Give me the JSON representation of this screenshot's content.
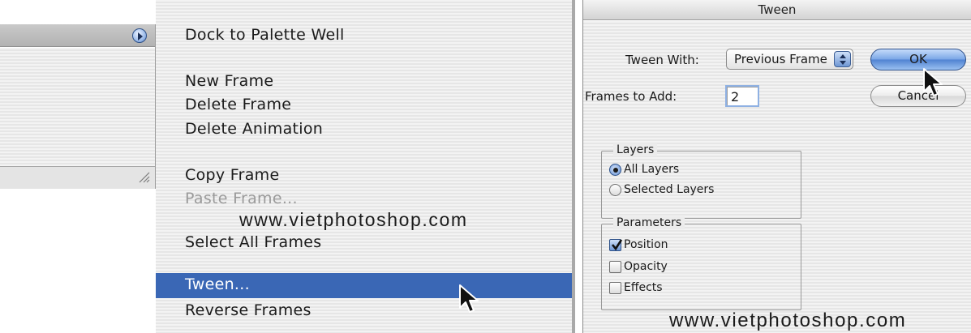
{
  "palette": {
    "menu_button_icon": "palette-menu-icon",
    "resize_icon": "resize-grip-icon"
  },
  "menu": {
    "items": [
      {
        "label": "Dock to Palette Well",
        "state": "normal"
      },
      {
        "label": "New Frame",
        "state": "normal"
      },
      {
        "label": "Delete Frame",
        "state": "normal"
      },
      {
        "label": "Delete Animation",
        "state": "normal"
      },
      {
        "label": "Copy Frame",
        "state": "normal"
      },
      {
        "label": "Paste Frame...",
        "state": "disabled"
      },
      {
        "label": "Select All Frames",
        "state": "normal"
      },
      {
        "label": "Tween...",
        "state": "selected"
      },
      {
        "label": "Reverse Frames",
        "state": "normal"
      }
    ],
    "highlight_color": "#3a67b5"
  },
  "watermark_text": "www.vietphotoshop.com",
  "dialog": {
    "title": "Tween",
    "tween_with_label": "Tween With:",
    "tween_with_value": "Previous Frame",
    "frames_to_add_label": "Frames to Add:",
    "frames_to_add_value": "2",
    "ok_label": "OK",
    "cancel_label": "Cancel",
    "layers_group": {
      "title": "Layers",
      "options": [
        {
          "label": "All Layers",
          "checked": true
        },
        {
          "label": "Selected Layers",
          "checked": false
        }
      ]
    },
    "parameters_group": {
      "title": "Parameters",
      "options": [
        {
          "label": "Position",
          "checked": true
        },
        {
          "label": "Opacity",
          "checked": false
        },
        {
          "label": "Effects",
          "checked": false
        }
      ]
    }
  },
  "colors": {
    "accent_blue": "#3a67b5",
    "ok_button": "#79a6e6"
  }
}
